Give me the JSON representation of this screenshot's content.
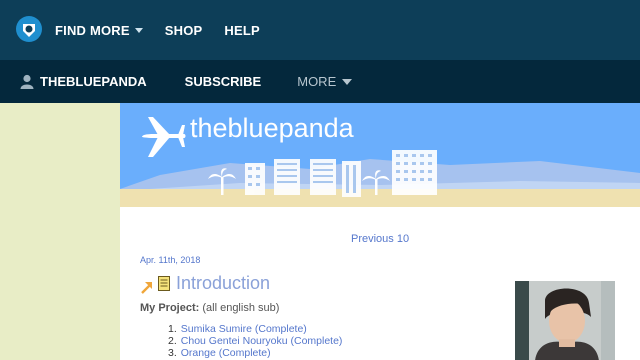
{
  "topnav": {
    "find_more": "FIND MORE",
    "shop": "SHOP",
    "help": "HELP"
  },
  "subnav": {
    "username": "THEBLUEPANDA",
    "subscribe": "SUBSCRIBE",
    "more": "MORE"
  },
  "blog": {
    "title": "thebluepanda"
  },
  "post": {
    "previous_link": "Previous 10",
    "date": "Apr. 11th, 2018",
    "title": "Introduction",
    "project_label": "My Project:",
    "project_note": "(all english sub)",
    "items": [
      {
        "num": "1.",
        "text": "Sumika Sumire (Complete)"
      },
      {
        "num": "2.",
        "text": "Chou Gentei Nouryoku (Complete)"
      },
      {
        "num": "3.",
        "text": "Orange (Complete)"
      }
    ]
  },
  "colors": {
    "topbar": "#0d3e58",
    "subbar": "#04283c",
    "sidebar": "#e8edc6",
    "banner_sky": "#6aaefc",
    "link": "#5577cc"
  },
  "icons": [
    "site-logo-icon",
    "chevron-down-icon",
    "user-icon",
    "airplane-icon",
    "arrow-icon",
    "note-icon"
  ]
}
